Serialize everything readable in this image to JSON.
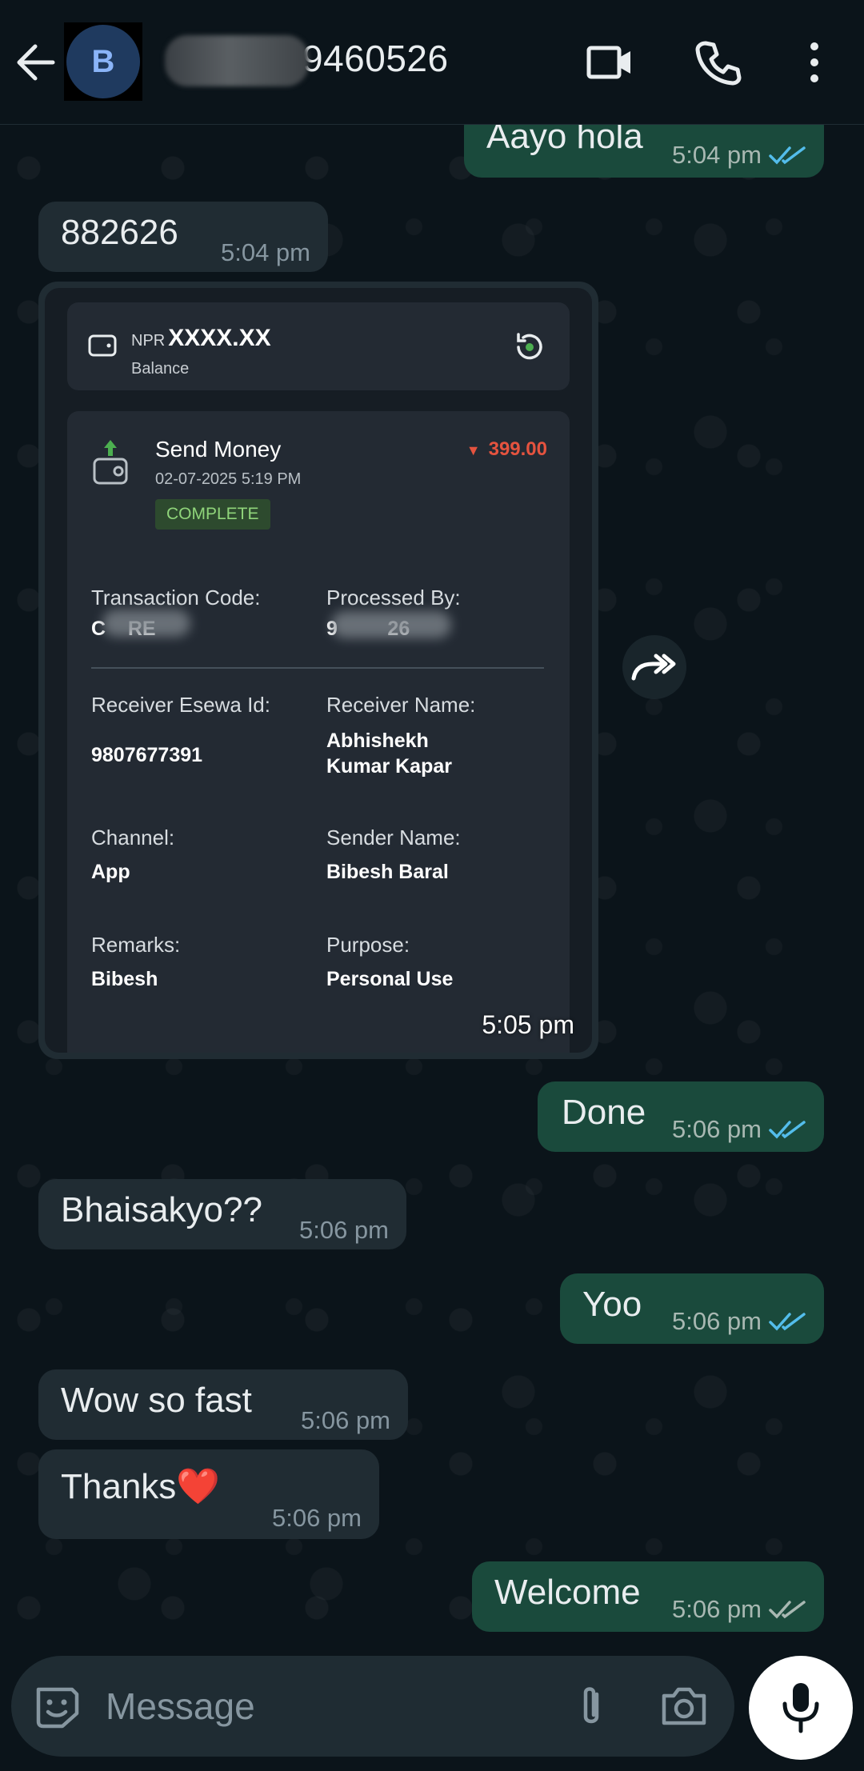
{
  "header": {
    "avatar_initial": "B",
    "contact_name": "9460526",
    "icons": [
      "back-arrow-icon",
      "video-call-icon",
      "voice-call-icon",
      "more-vert-icon"
    ]
  },
  "messages": [
    {
      "id": "m1",
      "direction": "out",
      "text": "Aayo hola",
      "time": "5:04 pm",
      "status": "read"
    },
    {
      "id": "m2",
      "direction": "in",
      "text": "882626",
      "time": "5:04 pm"
    },
    {
      "id": "m3",
      "direction": "in",
      "type": "image",
      "time": "5:05 pm"
    },
    {
      "id": "m4",
      "direction": "out",
      "text": "Done",
      "time": "5:06 pm",
      "status": "read"
    },
    {
      "id": "m5",
      "direction": "in",
      "text": "Bhaisakyo??",
      "time": "5:06 pm"
    },
    {
      "id": "m6",
      "direction": "out",
      "text": "Yoo",
      "time": "5:06 pm",
      "status": "read"
    },
    {
      "id": "m7",
      "direction": "in",
      "text": "Wow so fast",
      "time": "5:06 pm"
    },
    {
      "id": "m8",
      "direction": "in",
      "text": "Thanks❤️",
      "time": "5:06 pm"
    },
    {
      "id": "m9",
      "direction": "out",
      "text": "Welcome",
      "time": "5:06 pm",
      "status": "delivered"
    }
  ],
  "receipt": {
    "balance_currency": "NPR",
    "balance_amount": "XXXX.XX",
    "balance_label": "Balance",
    "tx_title": "Send Money",
    "tx_date": "02-07-2025 5:19 PM",
    "tx_status": "COMPLETE",
    "tx_amount": "399.00",
    "labels": {
      "transaction_code": "Transaction Code:",
      "processed_by": "Processed By:",
      "receiver_esewa_id": "Receiver Esewa Id:",
      "receiver_name": "Receiver Name:",
      "channel": "Channel:",
      "sender_name": "Sender Name:",
      "remarks": "Remarks:",
      "purpose": "Purpose:"
    },
    "values": {
      "transaction_code": "C    RE",
      "processed_by": "9         26",
      "receiver_esewa_id": "9807677391",
      "receiver_name_line1": "Abhishekh",
      "receiver_name_line2": "Kumar Kapar",
      "channel": "App",
      "sender_name": "Bibesh Baral",
      "remarks": "Bibesh",
      "purpose": "Personal Use"
    }
  },
  "composer": {
    "placeholder": "Message",
    "icons": [
      "emoji-icon",
      "attach-icon",
      "camera-icon",
      "mic-icon"
    ]
  },
  "colors": {
    "background": "#0b141a",
    "incoming_bubble": "#202c33",
    "outgoing_bubble": "#1a4a3c",
    "read_tick": "#53bdeb",
    "amount_red": "#e5533f",
    "status_green": "#8fd47a"
  }
}
